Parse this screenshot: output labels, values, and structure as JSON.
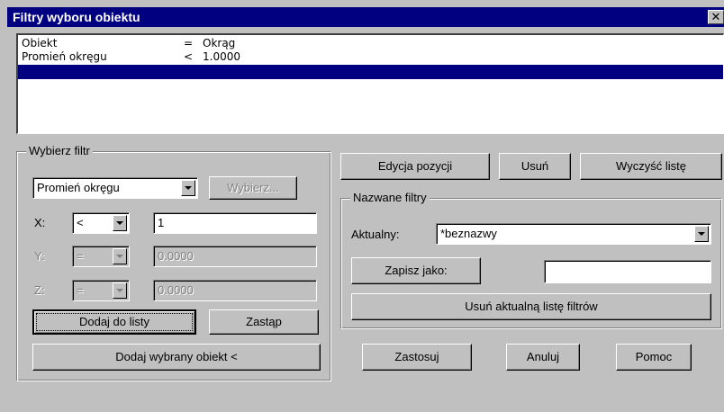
{
  "window": {
    "title": "Filtry wyboru obiektu",
    "close_symbol": "✕"
  },
  "filter_list": {
    "rows": [
      {
        "name": "Obiekt",
        "operator": "=",
        "value": "Okrąg"
      },
      {
        "name": "Promień okręgu",
        "operator": "<",
        "value": "1.0000"
      }
    ],
    "selected_row": ""
  },
  "select_filter": {
    "legend": "Wybierz filtr",
    "filter_type": "Promień okręgu",
    "select_button": "Wybierz...",
    "x": {
      "label": "X:",
      "operator": "<",
      "value": "1"
    },
    "y": {
      "label": "Y:",
      "operator": "=",
      "value": "0.0000"
    },
    "z": {
      "label": "Z:",
      "operator": "=",
      "value": "0.0000"
    },
    "add_to_list": "Dodaj do listy",
    "replace": "Zastąp",
    "add_selected_object": "Dodaj wybrany obiekt <"
  },
  "list_actions": {
    "edit_item": "Edycja pozycji",
    "delete": "Usuń",
    "clear_list": "Wyczyść listę"
  },
  "named_filters": {
    "legend": "Nazwane filtry",
    "current_label": "Aktualny:",
    "current_value": "*beznazwy",
    "save_as": "Zapisz jako:",
    "save_as_name": "",
    "delete_current": "Usuń aktualną listę filtrów"
  },
  "footer": {
    "apply": "Zastosuj",
    "cancel": "Anuluj",
    "help": "Pomoc"
  },
  "icons": {
    "dropdown_arrow": "chevron-down-icon",
    "close": "close-icon"
  }
}
